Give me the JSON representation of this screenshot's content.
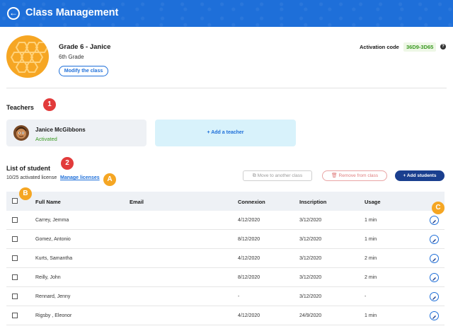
{
  "header": {
    "title": "Class Management",
    "back_icon": "arrow-left-icon"
  },
  "class_info": {
    "name": "Grade 6 - Janice",
    "grade": "6th Grade",
    "modify_label": "Modify the class",
    "activation_label": "Activation code",
    "activation_code": "36D9-3D65"
  },
  "teachers": {
    "title": "Teachers",
    "marker": "1",
    "list": [
      {
        "name": "Janice McGibbons",
        "status": "Activated"
      }
    ],
    "add_label": "+ Add a teacher"
  },
  "students": {
    "title": "List of student",
    "marker": "2",
    "license_text": "10/25 activated license",
    "manage_label": "Manage licenses",
    "manage_marker": "A",
    "move_label": "Move to another class",
    "remove_label": "Remove from class",
    "add_label": "+ Add students",
    "checkbox_marker": "B",
    "edit_marker": "C",
    "columns": [
      "Full Name",
      "Email",
      "Connexion",
      "Inscription",
      "Usage"
    ],
    "rows": [
      {
        "name": "Carrey, Jemma",
        "email": "",
        "connexion": "4/12/2020",
        "inscription": "3/12/2020",
        "usage": "1 min",
        "editable": true
      },
      {
        "name": "Gomez, Antonio",
        "email": "",
        "connexion": "8/12/2020",
        "inscription": "3/12/2020",
        "usage": "1 min",
        "editable": true
      },
      {
        "name": "Kurts, Samantha",
        "email": "",
        "connexion": "4/12/2020",
        "inscription": "3/12/2020",
        "usage": "2 min",
        "editable": true
      },
      {
        "name": "Reilly, John",
        "email": "",
        "connexion": "8/12/2020",
        "inscription": "3/12/2020",
        "usage": "2 min",
        "editable": true
      },
      {
        "name": "Rennard, Jenny",
        "email": "",
        "connexion": "-",
        "inscription": "3/12/2020",
        "usage": "-",
        "editable": true
      },
      {
        "name": "Rigsby , Eleonor",
        "email": "",
        "connexion": "4/12/2020",
        "inscription": "24/9/2020",
        "usage": "1 min",
        "editable": true
      }
    ]
  },
  "colors": {
    "primary": "#1e6fd9",
    "dark_button": "#1a3f8f",
    "success": "#3a9a22",
    "danger": "#e07d7d"
  }
}
